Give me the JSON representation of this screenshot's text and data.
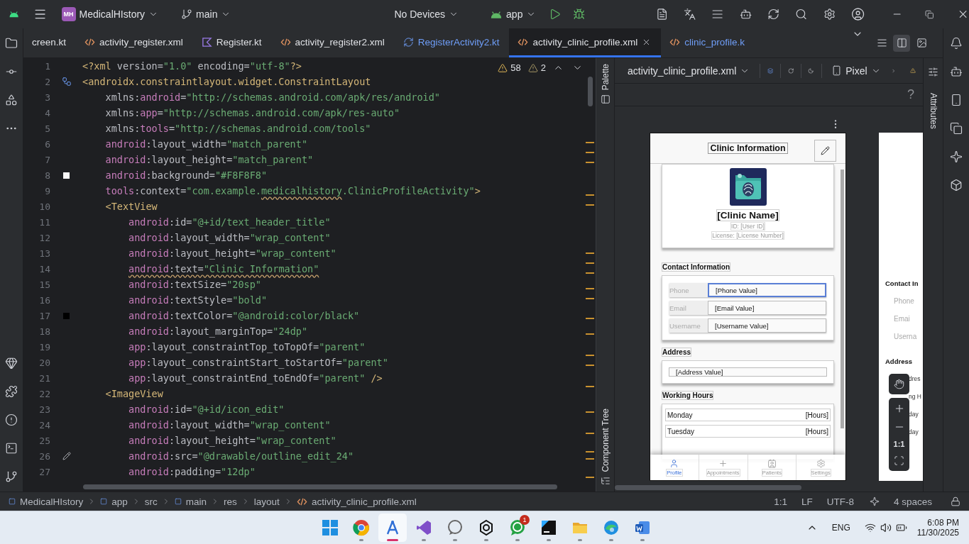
{
  "title_bar": {
    "project_badge": "MH",
    "project": "MedicalHIstory",
    "branch": "main",
    "device": "No Devices",
    "run_config": "app"
  },
  "tabs": [
    {
      "label": "creen.kt",
      "kind": "none",
      "added": false,
      "selected": false
    },
    {
      "label": "activity_register.xml",
      "kind": "xml",
      "added": false,
      "selected": false
    },
    {
      "label": "Register.kt",
      "kind": "kotlin",
      "added": false,
      "selected": false
    },
    {
      "label": "activity_register2.xml",
      "kind": "xml",
      "added": false,
      "selected": false
    },
    {
      "label": "RegisterActivity2.kt",
      "kind": "class",
      "added": true,
      "selected": false
    },
    {
      "label": "activity_clinic_profile.xml",
      "kind": "xml",
      "added": false,
      "selected": true
    },
    {
      "label": "clinic_profile.k",
      "kind": "xml",
      "added": true,
      "selected": false
    }
  ],
  "view_modes": [
    {
      "selected": false
    },
    {
      "selected": true
    },
    {
      "selected": false
    }
  ],
  "editor": {
    "warnings": "58",
    "weak_warnings": "2",
    "lines": [
      {
        "n": "1",
        "parts": [
          {
            "kind": "tag",
            "text": "<?xml "
          },
          {
            "kind": "plain",
            "text": "version="
          },
          {
            "kind": "str",
            "text": "\"1.0\""
          },
          {
            "kind": "plain",
            "text": " encoding="
          },
          {
            "kind": "str",
            "text": "\"utf-8\""
          },
          {
            "kind": "tag",
            "text": "?>"
          }
        ]
      },
      {
        "n": "2",
        "kind": "class",
        "parts": [
          {
            "kind": "tag",
            "text": "<androidx.constraintlayout.widget.ConstraintLayout"
          }
        ]
      },
      {
        "n": "3",
        "parts": [
          {
            "kind": "plain",
            "text": "    xmlns:"
          },
          {
            "kind": "ns",
            "text": "android"
          },
          {
            "kind": "plain",
            "text": "="
          },
          {
            "kind": "str",
            "text": "\"http://schemas.android.com/apk/res/android\""
          }
        ]
      },
      {
        "n": "4",
        "parts": [
          {
            "kind": "plain",
            "text": "    xmlns:"
          },
          {
            "kind": "ns",
            "text": "app"
          },
          {
            "kind": "plain",
            "text": "="
          },
          {
            "kind": "str",
            "text": "\"http://schemas.android.com/apk/res-auto\""
          }
        ]
      },
      {
        "n": "5",
        "parts": [
          {
            "kind": "plain",
            "text": "    xmlns:"
          },
          {
            "kind": "ns",
            "text": "tools"
          },
          {
            "kind": "plain",
            "text": "="
          },
          {
            "kind": "str",
            "text": "\"http://schemas.android.com/tools\""
          }
        ]
      },
      {
        "n": "6",
        "parts": [
          {
            "kind": "ns",
            "text": "    android"
          },
          {
            "kind": "plain",
            "text": ":layout_width="
          },
          {
            "kind": "str",
            "text": "\"match_parent\""
          }
        ]
      },
      {
        "n": "7",
        "parts": [
          {
            "kind": "ns",
            "text": "    android"
          },
          {
            "kind": "plain",
            "text": ":layout_height="
          },
          {
            "kind": "str",
            "text": "\"match_parent\""
          }
        ]
      },
      {
        "n": "8",
        "kind": "swatch",
        "color": "#f8f8f8",
        "parts": [
          {
            "kind": "ns",
            "text": "    android"
          },
          {
            "kind": "plain",
            "text": ":background="
          },
          {
            "kind": "str",
            "text": "\"#F8F8F8\""
          }
        ]
      },
      {
        "n": "9",
        "parts": [
          {
            "kind": "ns",
            "text": "    tools"
          },
          {
            "kind": "plain",
            "text": ":context="
          },
          {
            "kind": "str",
            "text": "\"com.example."
          },
          {
            "kind": "str",
            "text": "medicalhistory",
            "wavy": true
          },
          {
            "kind": "str",
            "text": ".ClinicProfileActivity\""
          },
          {
            "kind": "tag",
            "text": ">"
          }
        ]
      },
      {
        "n": "10",
        "parts": [
          {
            "kind": "tag",
            "text": "    <TextView"
          }
        ]
      },
      {
        "n": "11",
        "parts": [
          {
            "kind": "ns",
            "text": "        android"
          },
          {
            "kind": "plain",
            "text": ":id="
          },
          {
            "kind": "str",
            "text": "\"@+id/text_header_title\""
          }
        ]
      },
      {
        "n": "12",
        "parts": [
          {
            "kind": "ns",
            "text": "        android"
          },
          {
            "kind": "plain",
            "text": ":layout_width="
          },
          {
            "kind": "str",
            "text": "\"wrap_content\""
          }
        ]
      },
      {
        "n": "13",
        "parts": [
          {
            "kind": "ns",
            "text": "        android"
          },
          {
            "kind": "plain",
            "text": ":layout_height="
          },
          {
            "kind": "str",
            "text": "\"wrap_content\""
          }
        ]
      },
      {
        "n": "14",
        "parts": [
          {
            "kind": "ns",
            "text": "        android",
            "wavy": true
          },
          {
            "kind": "plain",
            "text": ":text=",
            "wavy": true
          },
          {
            "kind": "str",
            "text": "\"Clinic Information\"",
            "wavy": true
          }
        ]
      },
      {
        "n": "15",
        "parts": [
          {
            "kind": "ns",
            "text": "        android"
          },
          {
            "kind": "plain",
            "text": ":textSize="
          },
          {
            "kind": "str",
            "text": "\"20sp\""
          }
        ]
      },
      {
        "n": "16",
        "parts": [
          {
            "kind": "ns",
            "text": "        android"
          },
          {
            "kind": "plain",
            "text": ":textStyle="
          },
          {
            "kind": "str",
            "text": "\"bold\""
          }
        ]
      },
      {
        "n": "17",
        "kind": "swatch",
        "color": "#000000",
        "parts": [
          {
            "kind": "ns",
            "text": "        android"
          },
          {
            "kind": "plain",
            "text": ":textColor="
          },
          {
            "kind": "str",
            "text": "\"@android:color/black\""
          }
        ]
      },
      {
        "n": "18",
        "parts": [
          {
            "kind": "ns",
            "text": "        android"
          },
          {
            "kind": "plain",
            "text": ":layout_marginTop="
          },
          {
            "kind": "str",
            "text": "\"24dp\""
          }
        ]
      },
      {
        "n": "19",
        "parts": [
          {
            "kind": "ns",
            "text": "        app"
          },
          {
            "kind": "plain",
            "text": ":layout_constraintTop_toTopOf="
          },
          {
            "kind": "str",
            "text": "\"parent\""
          }
        ]
      },
      {
        "n": "20",
        "parts": [
          {
            "kind": "ns",
            "text": "        app"
          },
          {
            "kind": "plain",
            "text": ":layout_constraintStart_toStartOf="
          },
          {
            "kind": "str",
            "text": "\"parent\""
          }
        ]
      },
      {
        "n": "21",
        "parts": [
          {
            "kind": "ns",
            "text": "        app"
          },
          {
            "kind": "plain",
            "text": ":layout_constraintEnd_toEndOf="
          },
          {
            "kind": "str",
            "text": "\"parent\""
          },
          {
            "kind": "tag",
            "text": " />"
          }
        ]
      },
      {
        "n": "22",
        "parts": [
          {
            "kind": "tag",
            "text": "    <ImageView"
          }
        ]
      },
      {
        "n": "23",
        "parts": [
          {
            "kind": "ns",
            "text": "        android"
          },
          {
            "kind": "plain",
            "text": ":id="
          },
          {
            "kind": "str",
            "text": "\"@+id/icon_edit\""
          }
        ]
      },
      {
        "n": "24",
        "parts": [
          {
            "kind": "ns",
            "text": "        android"
          },
          {
            "kind": "plain",
            "text": ":layout_width="
          },
          {
            "kind": "str",
            "text": "\"wrap_content\""
          }
        ]
      },
      {
        "n": "25",
        "parts": [
          {
            "kind": "ns",
            "text": "        android"
          },
          {
            "kind": "plain",
            "text": ":layout_height="
          },
          {
            "kind": "str",
            "text": "\"wrap_content\""
          }
        ]
      },
      {
        "n": "26",
        "kind": "pencil",
        "parts": [
          {
            "kind": "ns",
            "text": "        android"
          },
          {
            "kind": "plain",
            "text": ":src="
          },
          {
            "kind": "str",
            "text": "\"@drawable/outline_edit_24\""
          }
        ]
      },
      {
        "n": "27",
        "parts": [
          {
            "kind": "ns",
            "text": "        android"
          },
          {
            "kind": "plain",
            "text": ":padding="
          },
          {
            "kind": "str",
            "text": "\"12dp\""
          }
        ]
      }
    ]
  },
  "design": {
    "file": "activity_clinic_profile.xml",
    "device": "Pixel",
    "palette_label": "Palette",
    "tree_label": "Component Tree",
    "help": "?",
    "zoom_reset": "1:1",
    "preview": {
      "header": "Clinic Information",
      "clinic_name": "[Clinic Name]",
      "id_line": "ID: [User ID]",
      "license_line": "License: [License Number]",
      "contact_title": "Contact Information",
      "contact": [
        {
          "label": "Phone",
          "value": "[Phone Value]",
          "selected": true
        },
        {
          "label": "Email",
          "value": "[Email Value]",
          "selected": false
        },
        {
          "label": "Username",
          "value": "[Username Value]",
          "selected": false
        }
      ],
      "address_title": "Address",
      "address": "[Address Value]",
      "hours_title": "Working Hours",
      "hours": [
        {
          "day": "Monday",
          "hours": "[Hours]"
        },
        {
          "day": "Tuesday",
          "hours": "[Hours]"
        }
      ],
      "nav": [
        {
          "label": "Profile",
          "selected": true
        },
        {
          "label": "Appointments",
          "selected": false
        },
        {
          "label": "Patients",
          "selected": false
        },
        {
          "label": "Settings",
          "selected": false
        }
      ]
    },
    "preview2": [
      {
        "kind": "title",
        "text": "Contact In"
      },
      {
        "kind": "label",
        "text": "Phone"
      },
      {
        "kind": "label",
        "text": "Emai"
      },
      {
        "kind": "label",
        "text": "Userna"
      },
      {
        "kind": "title",
        "text": "Address"
      },
      {
        "kind": "cut",
        "text": "dres"
      },
      {
        "kind": "cut",
        "text": "ng H"
      },
      {
        "kind": "cut",
        "text": "day"
      },
      {
        "kind": "cut",
        "text": "day"
      }
    ]
  },
  "attributes_label": "Attributes",
  "breadcrumbs": [
    {
      "label": "MedicalHIstory",
      "kind": "module"
    },
    {
      "label": "app",
      "kind": "module"
    },
    {
      "label": "src",
      "kind": "plain"
    },
    {
      "label": "main",
      "kind": "module"
    },
    {
      "label": "res",
      "kind": "plain"
    },
    {
      "label": "layout",
      "kind": "plain"
    },
    {
      "label": "activity_clinic_profile.xml",
      "kind": "xml"
    }
  ],
  "status": {
    "position": "1:1",
    "line_separator": "LF",
    "encoding": "UTF-8",
    "indent": "4 spaces"
  },
  "taskbar": {
    "apps": [
      {
        "active": false
      },
      {
        "active": true
      },
      {
        "active": false
      },
      {
        "active": false
      },
      {
        "active": false
      },
      {
        "active": false,
        "badge": "1"
      },
      {
        "active": false
      },
      {
        "active": false
      },
      {
        "active": false
      },
      {
        "active": false
      }
    ],
    "language": "ENG",
    "time": "6:08 PM",
    "date": "11/30/2025"
  }
}
